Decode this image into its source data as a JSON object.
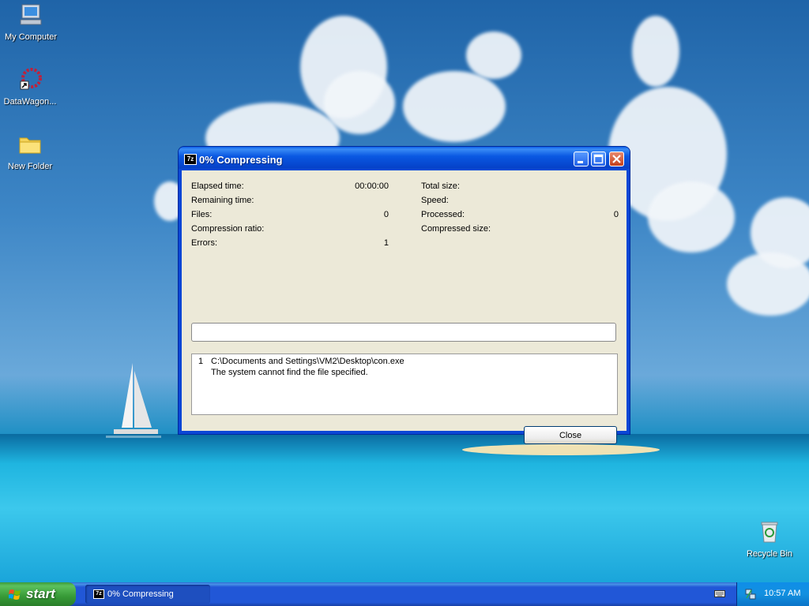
{
  "desktop": {
    "icons": [
      {
        "label": "My Computer"
      },
      {
        "label": "DataWagon..."
      },
      {
        "label": "New Folder"
      },
      {
        "label": "Recycle Bin"
      }
    ]
  },
  "dialog": {
    "title": "0% Compressing",
    "app_icon_text": "7z",
    "stats_left": [
      {
        "label": "Elapsed time:",
        "value": "00:00:00"
      },
      {
        "label": "Remaining time:",
        "value": ""
      },
      {
        "label": "Files:",
        "value": "0"
      },
      {
        "label": "Compression ratio:",
        "value": ""
      },
      {
        "label": "Errors:",
        "value": "1"
      }
    ],
    "stats_right": [
      {
        "label": "Total size:",
        "value": ""
      },
      {
        "label": "Speed:",
        "value": ""
      },
      {
        "label": "Processed:",
        "value": "0"
      },
      {
        "label": "Compressed size:",
        "value": ""
      }
    ],
    "progress": 0,
    "log": {
      "number": "1",
      "line1": "C:\\Documents and Settings\\VM2\\Desktop\\con.exe",
      "line2": "The system cannot find the file specified."
    },
    "close_label": "Close"
  },
  "taskbar": {
    "start_label": "start",
    "task_label": "0% Compressing",
    "task_icon_text": "7z",
    "clock": "10:57 AM"
  },
  "colors": {
    "titlebar": "#0a58e2",
    "dialog_bg": "#ece9d8",
    "start_green": "#379a37",
    "taskbar_blue": "#2157d7"
  }
}
